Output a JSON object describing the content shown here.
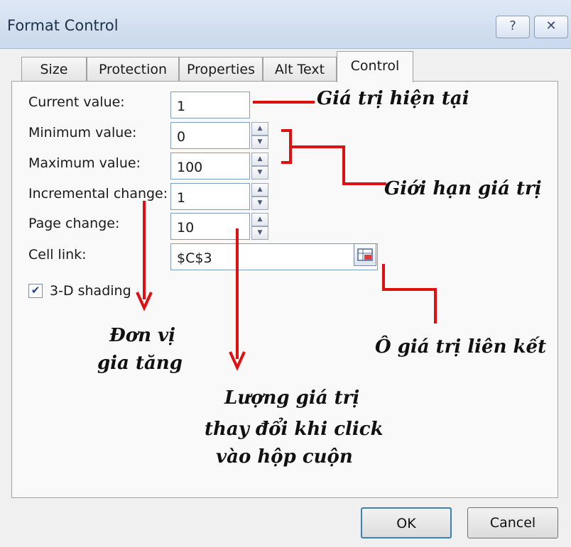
{
  "window": {
    "title": "Format Control",
    "help_icon": "question-mark",
    "close_icon": "close-x"
  },
  "tabs": [
    {
      "label": "Size"
    },
    {
      "label": "Protection"
    },
    {
      "label": "Properties"
    },
    {
      "label": "Alt Text"
    },
    {
      "label": "Control",
      "active": true
    }
  ],
  "control": {
    "current_value": {
      "label": "Current value:",
      "value": "1"
    },
    "minimum_value": {
      "label": "Minimum value:",
      "value": "0"
    },
    "maximum_value": {
      "label": "Maximum value:",
      "value": "100"
    },
    "incremental_change": {
      "label": "Incremental change:",
      "value": "1"
    },
    "page_change": {
      "label": "Page change:",
      "value": "10"
    },
    "cell_link": {
      "label": "Cell link:",
      "value": "$C$3"
    },
    "shading": {
      "label": "3-D shading",
      "checked": true
    }
  },
  "annotations": {
    "current": "Giá trị hiện tại",
    "limit": "Giới hạn giá trị",
    "increment_line1": "Đơn vị",
    "increment_line2": "gia tăng",
    "cell_link": "Ô giá trị liên kết",
    "page_line1": "Lượng giá trị",
    "page_line2": "thay đổi khi click",
    "page_line3": "vào hộp cuộn",
    "arrow_color": "#e01010"
  },
  "buttons": {
    "ok": "OK",
    "cancel": "Cancel"
  }
}
